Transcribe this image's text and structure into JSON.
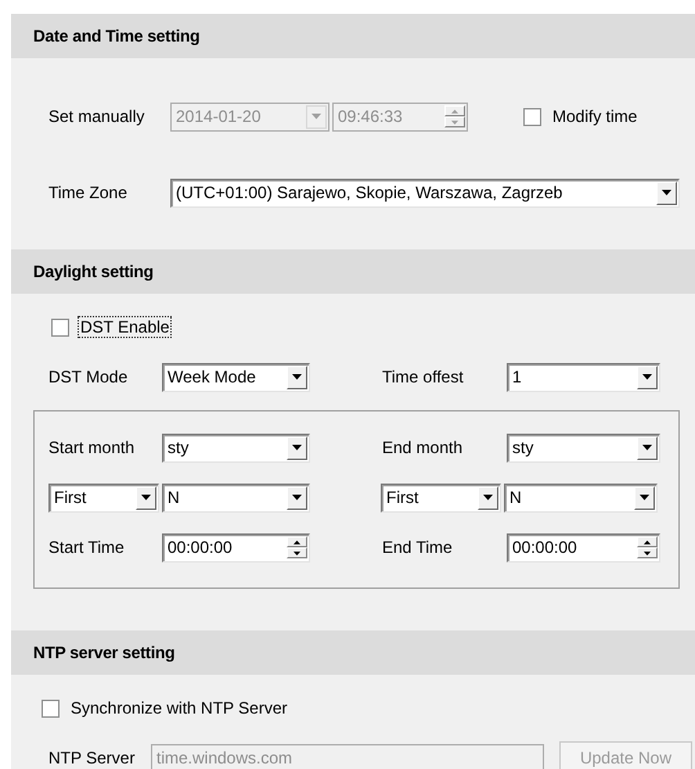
{
  "date_time": {
    "title": "Date and Time setting",
    "set_manually": {
      "label": "Set manually",
      "date": {
        "value": "2014-01-20",
        "disabled": true
      },
      "time": {
        "value": "09:46:33",
        "disabled": true
      }
    },
    "modify_time": {
      "label": "Modify time",
      "checked": false
    },
    "time_zone": {
      "label": "Time Zone",
      "value": "(UTC+01:00) Sarajewo, Skopie, Warszawa, Zagrzeb"
    }
  },
  "daylight": {
    "title": "Daylight setting",
    "dst_enable": {
      "label": "DST Enable",
      "checked": false,
      "focused": true
    },
    "dst_mode": {
      "label": "DST Mode",
      "value": "Week Mode"
    },
    "time_offset": {
      "label": "Time offest",
      "value": "1"
    },
    "start": {
      "month_label": "Start month",
      "month": "sty",
      "week": "First",
      "day": "N",
      "time_label": "Start Time",
      "time": "00:00:00"
    },
    "end": {
      "month_label": "End month",
      "month": "sty",
      "week": "First",
      "day": "N",
      "time_label": "End Time",
      "time": "00:00:00"
    }
  },
  "ntp": {
    "title": "NTP server setting",
    "sync": {
      "label": "Synchronize with NTP Server",
      "checked": false
    },
    "server": {
      "label": "NTP Server",
      "value": "time.windows.com",
      "disabled": true
    },
    "update_button": {
      "label": "Update Now",
      "disabled": true
    }
  }
}
